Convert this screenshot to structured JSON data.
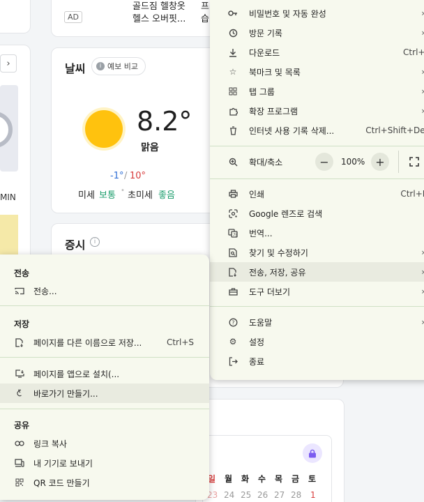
{
  "background": {
    "ad_badge": "AD",
    "ad_text_line1": "골드짐 헬창옷",
    "ad_text_line2": "헬스 오버핏...",
    "ad_text2_line1": "프",
    "ad_text2_line2": "습",
    "partial_label": "MIN",
    "weather": {
      "title": "날씨",
      "compare_button": "예보 비교",
      "temperature": "8.2°",
      "condition": "맑음",
      "low": "-1°",
      "slash": "/",
      "high": "10°",
      "fine_dust_label": "미세",
      "fine_dust_value": "보통",
      "ultra_dust_label": "초미세",
      "ultra_dust_value": "좋음"
    },
    "stock": {
      "title": "증시"
    },
    "calendar": {
      "days": [
        "일",
        "월",
        "화",
        "수",
        "목",
        "금",
        "토"
      ],
      "dates": [
        "23",
        "24",
        "25",
        "26",
        "27",
        "28",
        "1"
      ]
    }
  },
  "main_menu": {
    "items": [
      {
        "label": "비밀번호 및 자동 완성",
        "icon": "key-icon",
        "arrow": "›"
      },
      {
        "label": "방문 기록",
        "icon": "history-icon",
        "arrow": "›"
      },
      {
        "label": "다운로드",
        "icon": "download-icon",
        "shortcut": "Ctrl+J"
      },
      {
        "label": "북마크 및 목록",
        "icon": "star-icon",
        "arrow": "›"
      },
      {
        "label": "탭 그룹",
        "icon": "tab-groups-icon",
        "arrow": "›"
      },
      {
        "label": "확장 프로그램",
        "icon": "puzzle-icon",
        "arrow": "›"
      },
      {
        "label": "인터넷 사용 기록 삭제...",
        "icon": "trash-icon",
        "shortcut": "Ctrl+Shift+Del"
      }
    ],
    "zoom": {
      "label": "확대/축소",
      "minus": "−",
      "value": "100%",
      "plus": "+"
    },
    "items2": [
      {
        "label": "인쇄",
        "icon": "print-icon",
        "shortcut": "Ctrl+P"
      },
      {
        "label": "Google 렌즈로 검색",
        "icon": "lens-icon"
      },
      {
        "label": "번역...",
        "icon": "translate-icon"
      },
      {
        "label": "찾기 및 수정하기",
        "icon": "find-icon",
        "arrow": "›"
      },
      {
        "label": "전송, 저장, 공유",
        "icon": "share-icon",
        "arrow": "›"
      },
      {
        "label": "도구 더보기",
        "icon": "toolbox-icon",
        "arrow": "›"
      }
    ],
    "items3": [
      {
        "label": "도움말",
        "icon": "help-icon",
        "arrow": "›"
      },
      {
        "label": "설정",
        "icon": "settings-icon"
      },
      {
        "label": "종료",
        "icon": "exit-icon"
      }
    ]
  },
  "sub_menu": {
    "cast_header": "전송",
    "cast_item": "전송...",
    "save_header": "저장",
    "save_page": "페이지를 다른 이름으로 저장...",
    "save_page_shortcut": "Ctrl+S",
    "install_app": "페이지를 앱으로 설치(...",
    "create_shortcut": "바로가기 만들기...",
    "share_header": "공유",
    "copy_link": "링크 복사",
    "send_devices": "내 기기로 보내기",
    "qr_code": "QR 코드 만들기"
  },
  "colors": {
    "menu_bg": "#f7f9ee",
    "separator": "#cfe0c5",
    "low_temp": "#2f6fd6",
    "high_temp": "#d83b3b",
    "dust_good": "#1a9c6b",
    "sun": "#ffc20e"
  }
}
